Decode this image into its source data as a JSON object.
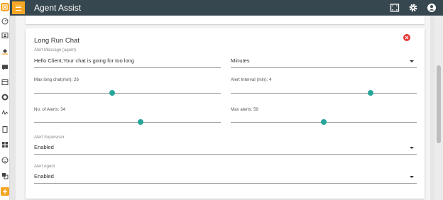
{
  "app": {
    "title": "Agent Assist"
  },
  "colors": {
    "topbar": "#37474f",
    "accent": "#f5a623",
    "slider": "#26a69a",
    "close": "#e53935"
  },
  "rail_icons": [
    "brand-logo-icon",
    "speedometer-icon",
    "contact-card-icon",
    "paint-bucket-icon",
    "chat-icon",
    "window-icon",
    "donut-icon",
    "signature-icon",
    "clipboard-icon",
    "grid-icon",
    "smiley-icon",
    "translate-icon",
    "add-icon"
  ],
  "topbar_icons": [
    "screen-capture-icon",
    "settings-icon",
    "account-icon"
  ],
  "card": {
    "title": "Long Run Chat",
    "alert_message": {
      "label": "Alert Message (agent)",
      "value": "Hello Client,Your chat is going for too long"
    },
    "unit_select": {
      "value": "Minutes"
    },
    "max_long_chat": {
      "label": "Max long chat(min): 26",
      "value": 26,
      "fraction": 0.42
    },
    "alert_interval": {
      "label": "Alert Interval (min): 4",
      "value": 4,
      "fraction": 0.75
    },
    "no_of_alerts": {
      "label": "No. of Alerts: 34",
      "value": 34,
      "fraction": 0.57
    },
    "max_alerts": {
      "label": "Max alerts: 59",
      "value": 59,
      "fraction": 0.5
    },
    "alert_supervisor": {
      "label": "Alert Supervisor",
      "value": "Enabled"
    },
    "alert_agent": {
      "label": "Alert Agent",
      "value": "Enabled"
    }
  }
}
